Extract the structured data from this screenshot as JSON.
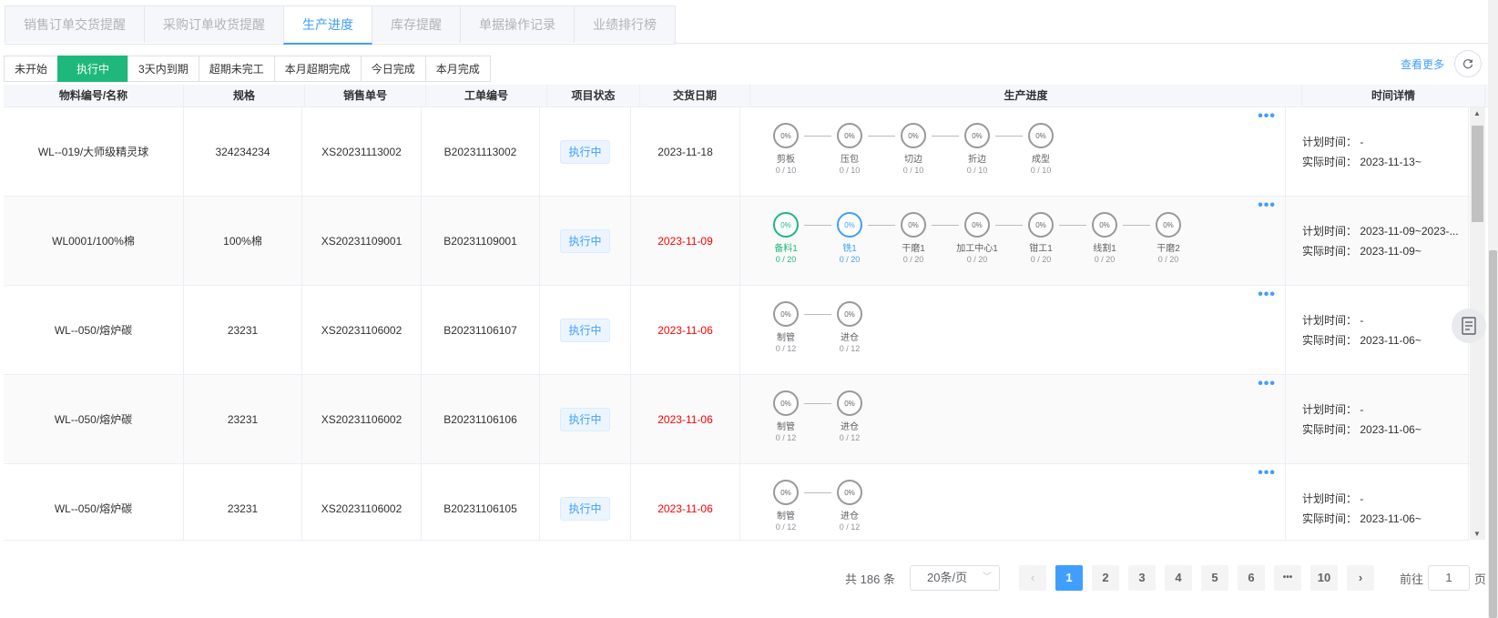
{
  "tabs": [
    "销售订单交货提醒",
    "采购订单收货提醒",
    "生产进度",
    "库存提醒",
    "单据操作记录",
    "业绩排行榜"
  ],
  "active_tab": 2,
  "filters": [
    "未开始",
    "执行中",
    "3天内到期",
    "超期未完工",
    "本月超期完成",
    "今日完成",
    "本月完成"
  ],
  "active_filter": 1,
  "more_label": "查看更多",
  "columns": [
    "物料编号/名称",
    "规格",
    "销售单号",
    "工单编号",
    "项目状态",
    "交货日期",
    "生产进度",
    "时间详情"
  ],
  "time_labels": {
    "plan": "计划时间：",
    "actual": "实际时间："
  },
  "rows": [
    {
      "material": "WL--019/大师级精灵球",
      "spec": "324234234",
      "sales_no": "XS20231113002",
      "work_no": "B20231113002",
      "status": "执行中",
      "delivery": "2023-11-18",
      "overdue": false,
      "plan_time": "-",
      "actual_time": "2023-11-13~",
      "steps": [
        {
          "pct": "0%",
          "name": "剪板",
          "count": "0 / 10",
          "color": "gray"
        },
        {
          "pct": "0%",
          "name": "压包",
          "count": "0 / 10",
          "color": "gray"
        },
        {
          "pct": "0%",
          "name": "切边",
          "count": "0 / 10",
          "color": "gray"
        },
        {
          "pct": "0%",
          "name": "折边",
          "count": "0 / 10",
          "color": "gray"
        },
        {
          "pct": "0%",
          "name": "成型",
          "count": "0 / 10",
          "color": "gray"
        }
      ]
    },
    {
      "material": "WL0001/100%棉",
      "spec": "100%棉",
      "sales_no": "XS20231109001",
      "work_no": "B20231109001",
      "status": "执行中",
      "delivery": "2023-11-09",
      "overdue": true,
      "plan_time": "2023-11-09~2023-...",
      "actual_time": "2023-11-09~",
      "steps": [
        {
          "pct": "0%",
          "name": "备料1",
          "count": "0 / 20",
          "color": "green"
        },
        {
          "pct": "0%",
          "name": "铣1",
          "count": "0 / 20",
          "color": "blue"
        },
        {
          "pct": "0%",
          "name": "干磨1",
          "count": "0 / 20",
          "color": "gray"
        },
        {
          "pct": "0%",
          "name": "加工中心1",
          "count": "0 / 20",
          "color": "gray"
        },
        {
          "pct": "0%",
          "name": "钳工1",
          "count": "0 / 20",
          "color": "gray"
        },
        {
          "pct": "0%",
          "name": "线割1",
          "count": "0 / 20",
          "color": "gray"
        },
        {
          "pct": "0%",
          "name": "干磨2",
          "count": "0 / 20",
          "color": "gray"
        }
      ]
    },
    {
      "material": "WL--050/熔炉碳",
      "spec": "23231",
      "sales_no": "XS20231106002",
      "work_no": "B20231106107",
      "status": "执行中",
      "delivery": "2023-11-06",
      "overdue": true,
      "plan_time": "-",
      "actual_time": "2023-11-06~",
      "steps": [
        {
          "pct": "0%",
          "name": "制管",
          "count": "0 / 12",
          "color": "gray"
        },
        {
          "pct": "0%",
          "name": "进仓",
          "count": "0 / 12",
          "color": "gray"
        }
      ]
    },
    {
      "material": "WL--050/熔炉碳",
      "spec": "23231",
      "sales_no": "XS20231106002",
      "work_no": "B20231106106",
      "status": "执行中",
      "delivery": "2023-11-06",
      "overdue": true,
      "plan_time": "-",
      "actual_time": "2023-11-06~",
      "steps": [
        {
          "pct": "0%",
          "name": "制管",
          "count": "0 / 12",
          "color": "gray"
        },
        {
          "pct": "0%",
          "name": "进仓",
          "count": "0 / 12",
          "color": "gray"
        }
      ]
    },
    {
      "material": "WL--050/熔炉碳",
      "spec": "23231",
      "sales_no": "XS20231106002",
      "work_no": "B20231106105",
      "status": "执行中",
      "delivery": "2023-11-06",
      "overdue": true,
      "plan_time": "-",
      "actual_time": "2023-11-06~",
      "steps": [
        {
          "pct": "0%",
          "name": "制管",
          "count": "0 / 12",
          "color": "gray"
        },
        {
          "pct": "0%",
          "name": "进仓",
          "count": "0 / 12",
          "color": "gray"
        }
      ]
    }
  ],
  "pagination": {
    "total": "共 186 条",
    "page_size": "20条/页",
    "pages": [
      "1",
      "2",
      "3",
      "4",
      "5",
      "6",
      "•••",
      "10"
    ],
    "current": "1",
    "goto_prefix": "前往",
    "goto_value": "1",
    "goto_suffix": "页"
  },
  "icons": {
    "refresh": "refresh-icon",
    "document": "document-icon",
    "more": "more-dots-icon"
  },
  "colors": {
    "accent": "#409eff",
    "active_filter": "#1fb87c",
    "overdue": "#ff0000"
  }
}
